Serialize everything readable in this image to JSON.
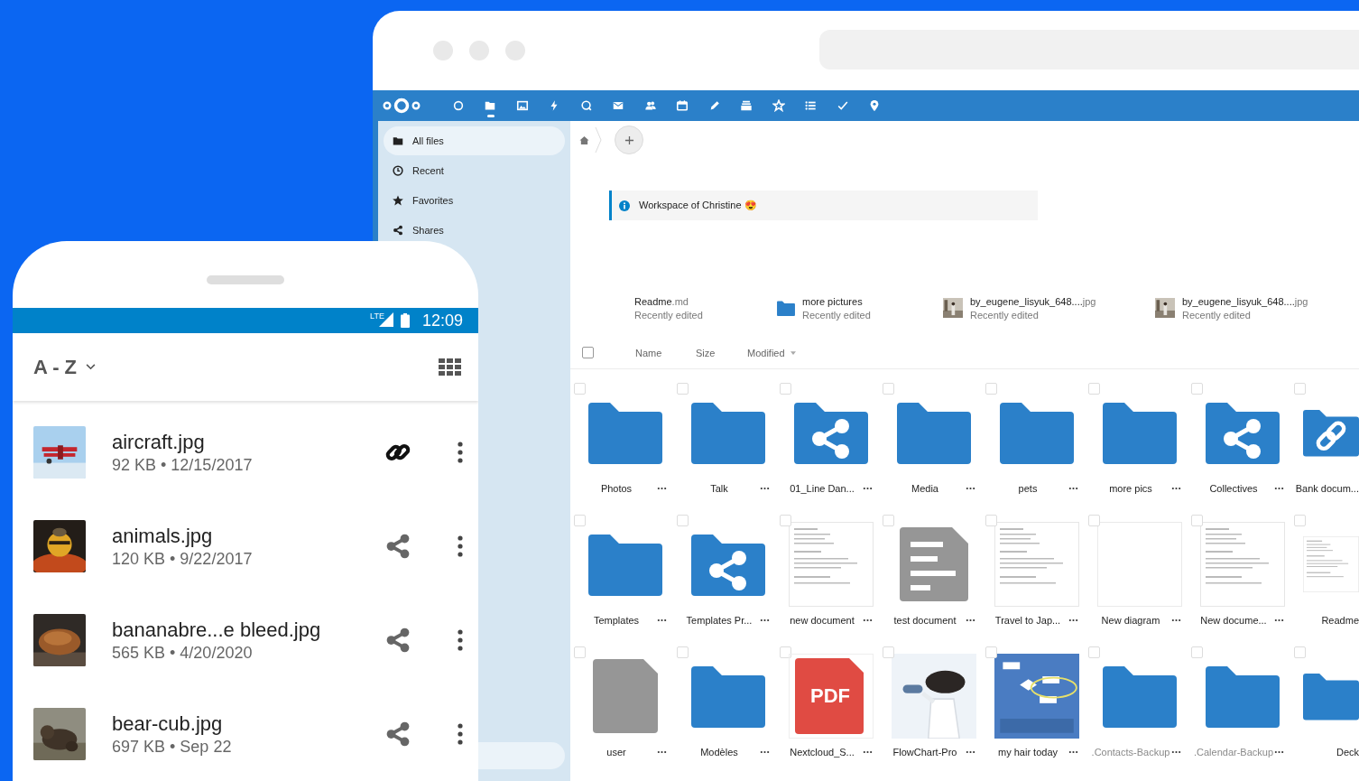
{
  "app_bar": {
    "apps": [
      {
        "selected": false
      },
      {
        "selected": true
      },
      {
        "selected": false
      },
      {
        "selected": false
      },
      {
        "selected": false
      },
      {
        "selected": false
      },
      {
        "selected": false
      },
      {
        "selected": false
      },
      {
        "selected": false
      },
      {
        "selected": false
      },
      {
        "selected": false
      },
      {
        "selected": false
      },
      {
        "selected": false
      },
      {
        "selected": false
      }
    ]
  },
  "sidebar": {
    "items": [
      {
        "label": "All files",
        "selected": true
      },
      {
        "label": "Recent",
        "selected": false
      },
      {
        "label": "Favorites",
        "selected": false
      },
      {
        "label": "Shares",
        "selected": false
      }
    ]
  },
  "info_banner": {
    "text": "Workspace of Christine 😍"
  },
  "recent": [
    {
      "name": "Readme",
      "ext": ".md",
      "subtitle": "Recently edited",
      "kind": "text"
    },
    {
      "name": "more pictures",
      "subtitle": "Recently edited",
      "kind": "folder"
    },
    {
      "name": "by_eugene_lisyuk_648....",
      "ext": "jpg",
      "subtitle": "Recently edited",
      "kind": "picture"
    },
    {
      "name": "by_eugene_lisyuk_648....",
      "ext": "jpg",
      "subtitle": "Recently edited",
      "kind": "picture"
    }
  ],
  "file_list": {
    "all_checked": false,
    "columns": [
      {
        "label": "Name",
        "sorted": false
      },
      {
        "label": "Size",
        "sorted": false
      },
      {
        "label": "Modified",
        "sorted": true
      }
    ]
  },
  "files": [
    {
      "name": "Photos",
      "kind": "folder",
      "hidden": false,
      "checked": false
    },
    {
      "name": "Talk",
      "kind": "folder",
      "hidden": false,
      "checked": false
    },
    {
      "name": "01_Line Dan...",
      "kind": "shared",
      "hidden": false,
      "checked": false
    },
    {
      "name": "Media",
      "kind": "folder",
      "hidden": false,
      "checked": false
    },
    {
      "name": "pets",
      "kind": "folder",
      "hidden": false,
      "checked": false
    },
    {
      "name": "more pics",
      "kind": "folder",
      "hidden": false,
      "checked": false
    },
    {
      "name": "Collectives",
      "kind": "shared",
      "hidden": false,
      "checked": false
    },
    {
      "name": "Bank docum...",
      "kind": "linked",
      "hidden": false,
      "checked": false
    },
    {
      "name": "Templates",
      "kind": "folder",
      "hidden": false,
      "checked": false
    },
    {
      "name": "Templates Pr...",
      "kind": "shared",
      "hidden": false,
      "checked": false
    },
    {
      "name": "new document",
      "kind": "document",
      "hidden": false,
      "checked": false
    },
    {
      "name": "test document",
      "kind": "textfile",
      "hidden": false,
      "checked": false
    },
    {
      "name": "Travel to Jap...",
      "kind": "document",
      "hidden": false,
      "checked": false
    },
    {
      "name": "New diagram",
      "kind": "blank",
      "hidden": false,
      "checked": false
    },
    {
      "name": "New docume...",
      "kind": "document",
      "hidden": false,
      "checked": false
    },
    {
      "name": "Readme",
      "kind": "document",
      "hidden": false,
      "checked": false
    },
    {
      "name": "user",
      "kind": "file",
      "hidden": false,
      "checked": false
    },
    {
      "name": "Modèles",
      "kind": "folder",
      "hidden": false,
      "checked": false
    },
    {
      "name": "Nextcloud_S...",
      "kind": "pdf",
      "badge": "PDF",
      "hidden": false,
      "checked": false
    },
    {
      "name": "FlowChart-Pro",
      "kind": "picture",
      "hidden": false,
      "checked": false
    },
    {
      "name": "my hair today",
      "kind": "picture",
      "hidden": false,
      "checked": false
    },
    {
      "name": ".Contacts-Backup",
      "kind": "folder",
      "hidden": true,
      "checked": false
    },
    {
      "name": ".Calendar-Backup",
      "kind": "folder",
      "hidden": true,
      "checked": false
    },
    {
      "name": "Deck",
      "kind": "folder",
      "hidden": false,
      "checked": false
    }
  ],
  "phone": {
    "status_bar": {
      "network": "LTE",
      "time": "12:09"
    },
    "sort_label": "A - Z",
    "files": [
      {
        "name": "aircraft.jpg",
        "meta": "92 KB • 12/15/2017",
        "link_shared": true
      },
      {
        "name": "animals.jpg",
        "meta": "120 KB • 9/22/2017",
        "link_shared": false
      },
      {
        "name": "bananabre...e bleed.jpg",
        "meta": "565 KB • 4/20/2020",
        "link_shared": false
      },
      {
        "name": "bear-cub.jpg",
        "meta": "697 KB • Sep 22",
        "link_shared": false
      }
    ]
  }
}
